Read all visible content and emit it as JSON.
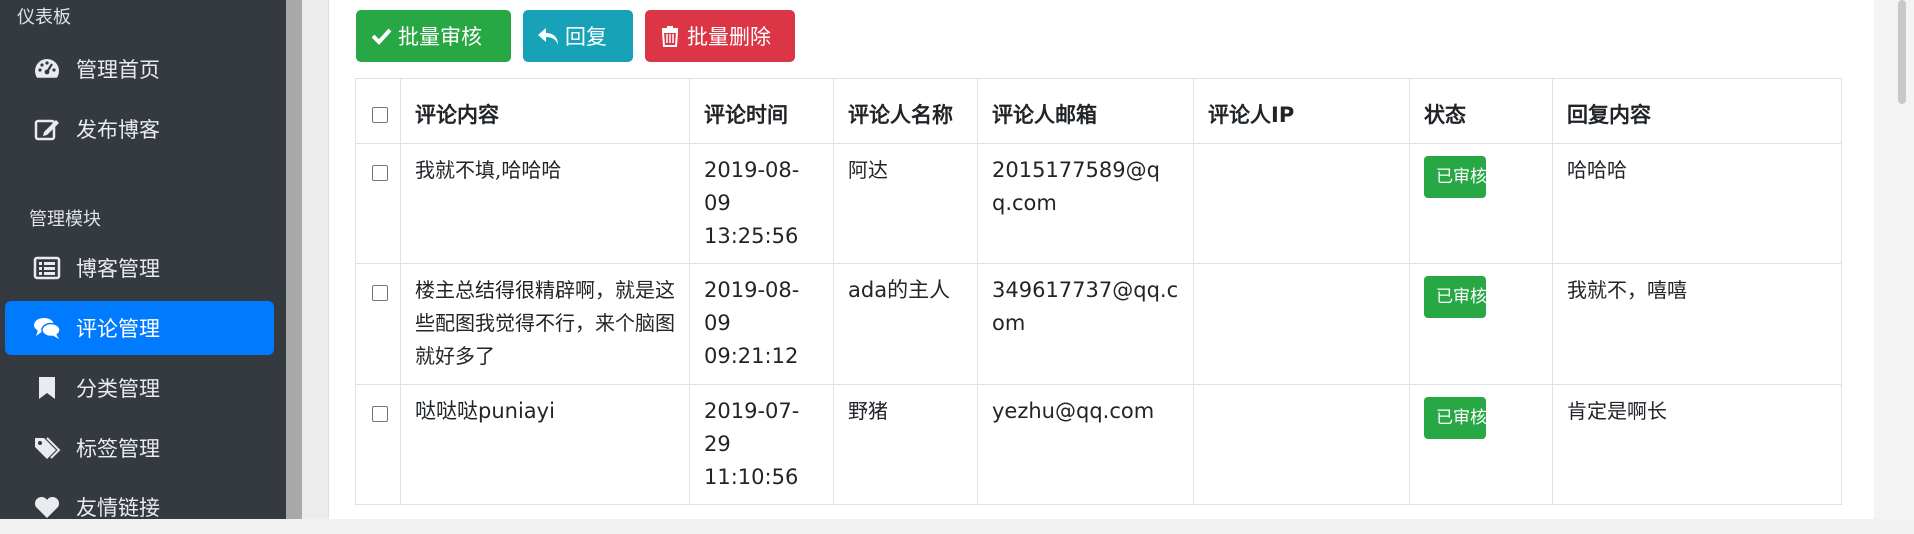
{
  "sidebar": {
    "section_dashboard": "仪表板",
    "section_manage": "管理模块",
    "items": [
      {
        "label": "管理首页",
        "icon": "dashboard-icon"
      },
      {
        "label": "发布博客",
        "icon": "edit-icon"
      },
      {
        "label": "博客管理",
        "icon": "list-icon"
      },
      {
        "label": "评论管理",
        "icon": "comments-icon",
        "active": true
      },
      {
        "label": "分类管理",
        "icon": "bookmark-icon"
      },
      {
        "label": "标签管理",
        "icon": "tags-icon"
      },
      {
        "label": "友情链接",
        "icon": "heart-icon"
      }
    ]
  },
  "toolbar": {
    "batch_review": "批量审核",
    "reply": "回复",
    "batch_delete": "批量删除"
  },
  "table": {
    "headers": [
      "评论内容",
      "评论时间",
      "评论人名称",
      "评论人邮箱",
      "评论人IP",
      "状态",
      "回复内容"
    ],
    "rows": [
      {
        "content": "我就不填,哈哈哈",
        "time": "2019-08-09 13:25:56",
        "name": "阿达",
        "email": "2015177589@qq.com",
        "ip": "",
        "status": "已审核",
        "reply": "哈哈哈"
      },
      {
        "content": "楼主总结得很精辟啊，就是这些配图我觉得不行，来个脑图就好多了",
        "time": "2019-08-09 09:21:12",
        "name": "ada的主人",
        "email": "349617737@qq.com",
        "ip": "",
        "status": "已审核",
        "reply": "我就不，嘻嘻"
      },
      {
        "content": "哒哒哒puniayi",
        "time": "2019-07-29 11:10:56",
        "name": "野猪",
        "email": "yezhu@qq.com",
        "ip": "",
        "status": "已审核",
        "reply": "肯定是啊长"
      }
    ]
  },
  "colors": {
    "sidebar_bg": "#343a40",
    "active": "#007bff",
    "success": "#28a745",
    "info": "#17a2b8",
    "danger": "#dc3545"
  }
}
